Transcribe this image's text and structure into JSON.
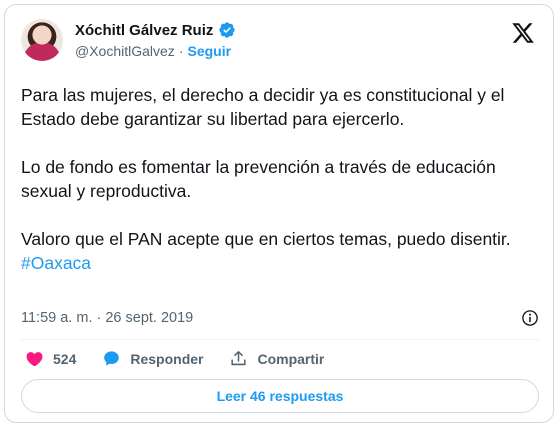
{
  "author": {
    "name": "Xóchitl Gálvez Ruiz",
    "handle": "@XochitlGalvez",
    "separator": "·",
    "follow_label": "Seguir"
  },
  "tweet": {
    "paragraphs": [
      "Para las mujeres, el derecho a decidir ya es constitucional y el Estado debe garantizar su libertad para ejercerlo.",
      "Lo de fondo es fomentar la prevención a través de educación sexual y reproductiva.",
      "Valoro que el PAN acepte que en ciertos temas, puedo disentir."
    ],
    "hashtag": "#Oaxaca",
    "timestamp": "11:59 a. m. · 26 sept. 2019"
  },
  "actions": {
    "likes_count": "524",
    "reply_label": "Responder",
    "share_label": "Compartir"
  },
  "read_replies_label": "Leer 46 respuestas",
  "colors": {
    "accent": "#1d9bf0",
    "like": "#f91880",
    "text": "#0f1419",
    "muted": "#536471",
    "border": "#cfd9de"
  },
  "icons": [
    "verified-badge-icon",
    "x-logo-icon",
    "info-icon",
    "heart-icon",
    "reply-bubble-icon",
    "share-icon"
  ]
}
